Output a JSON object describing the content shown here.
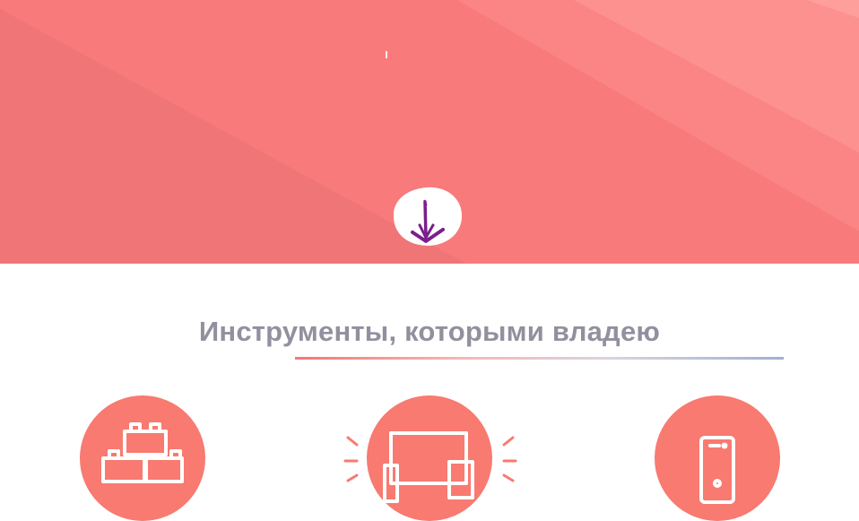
{
  "hero": {
    "background": "#f87a7b",
    "scroll_icon": "arrow-down-icon"
  },
  "skills_section": {
    "title": "Инструменты, которыми владею",
    "title_color": "#92909e",
    "accent": "#f87a70",
    "items": [
      {
        "icon": "blocks-icon"
      },
      {
        "icon": "devices-icon"
      },
      {
        "icon": "smartphone-icon"
      }
    ]
  }
}
